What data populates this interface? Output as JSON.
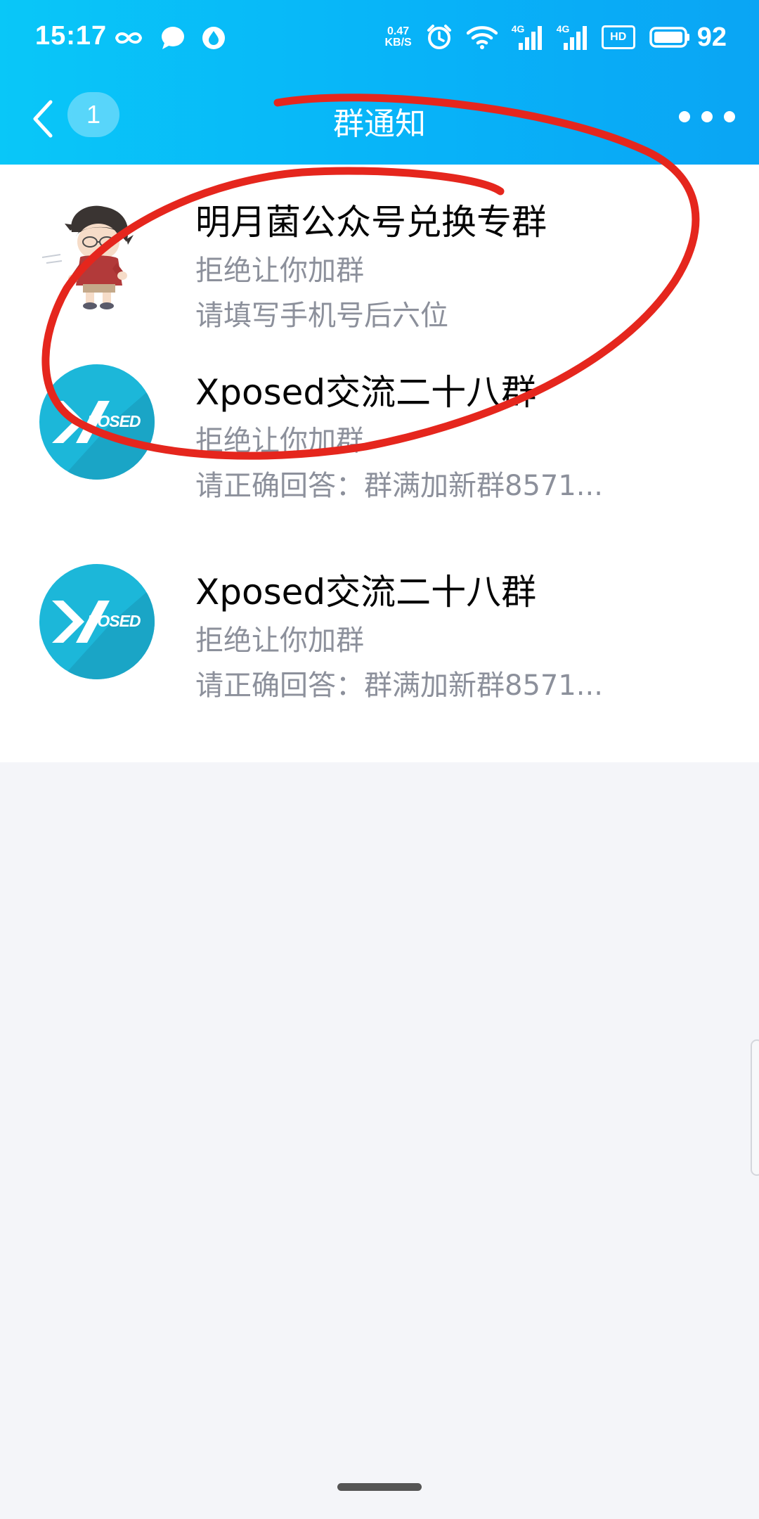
{
  "status_bar": {
    "time": "15:17",
    "net_speed_value": "0.47",
    "net_speed_unit": "KB/S",
    "signal_1": "4G",
    "signal_2": "4G",
    "hd_label": "HD",
    "battery": "92",
    "icons": [
      "infinity-icon",
      "chat-bubble-icon",
      "drop-icon",
      "alarm-icon",
      "wifi-icon",
      "signal-icon",
      "hd-icon",
      "battery-icon"
    ]
  },
  "title_bar": {
    "back_count": "1",
    "title": "群通知",
    "icons": [
      "back-chevron-icon",
      "more-icon"
    ]
  },
  "notifications": [
    {
      "avatar": "anime-character-avatar",
      "title": "明月菌公众号兑换专群",
      "status": "拒绝让你加群",
      "note": "请填写手机号后六位"
    },
    {
      "avatar": "xposed-logo-avatar",
      "logo_text": "POSED",
      "title": "Xposed交流二十八群",
      "status": "拒绝让你加群",
      "note": "请正确回答：群满加新群8571..."
    },
    {
      "avatar": "xposed-logo-avatar",
      "logo_text": "POSED",
      "title": "Xposed交流二十八群",
      "status": "拒绝让你加群",
      "note": "请正确回答：群满加新群8571..."
    }
  ],
  "colors": {
    "header_gradient_start": "#09c7f8",
    "header_gradient_end": "#0aa5f4",
    "annotation_red": "#e5261d",
    "secondary_text": "#8c909b",
    "page_background": "#f4f5f9"
  }
}
